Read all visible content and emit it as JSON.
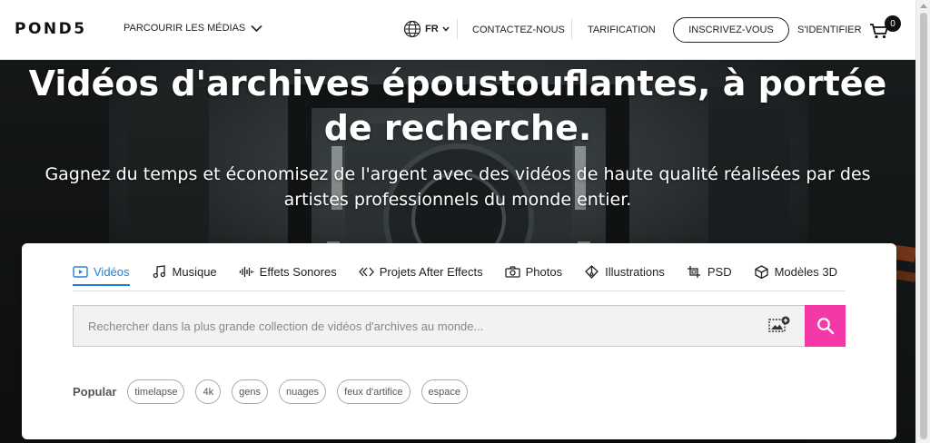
{
  "header": {
    "logo": "POND5",
    "browse_label": "PARCOURIR LES MÉDIAS",
    "language": "FR",
    "contact_label": "CONTACTEZ-NOUS",
    "pricing_label": "TARIFICATION",
    "signup_label": "INSCRIVEZ-VOUS",
    "login_label": "S'IDENTIFIER",
    "cart_count": "0"
  },
  "hero": {
    "title_line1": "Vidéos d'archives époustouflantes, à portée",
    "title_line2": "de recherche.",
    "subtitle_line1": "Gagnez du temps et économisez de l'argent avec des vidéos de haute qualité réalisées par des",
    "subtitle_line2": "artistes professionnels du monde entier."
  },
  "search": {
    "tabs": [
      {
        "label": "Vidéos",
        "icon": "video-icon"
      },
      {
        "label": "Musique",
        "icon": "music-note-icon"
      },
      {
        "label": "Effets Sonores",
        "icon": "waveform-icon"
      },
      {
        "label": "Projets After Effects",
        "icon": "after-effects-icon"
      },
      {
        "label": "Photos",
        "icon": "camera-icon"
      },
      {
        "label": "Illustrations",
        "icon": "illustration-icon"
      },
      {
        "label": "PSD",
        "icon": "psd-icon"
      },
      {
        "label": "Modèles 3D",
        "icon": "cube-icon"
      }
    ],
    "active_tab": "Vidéos",
    "placeholder": "Rechercher dans la plus grande collection de vidéos d'archives au monde...",
    "popular_label": "Popular",
    "popular_terms": [
      "timelapse",
      "4k",
      "gens",
      "nuages",
      "feux d'artifice",
      "espace"
    ]
  },
  "colors": {
    "accent_blue": "#2580d5",
    "search_button": "#f339a8"
  }
}
